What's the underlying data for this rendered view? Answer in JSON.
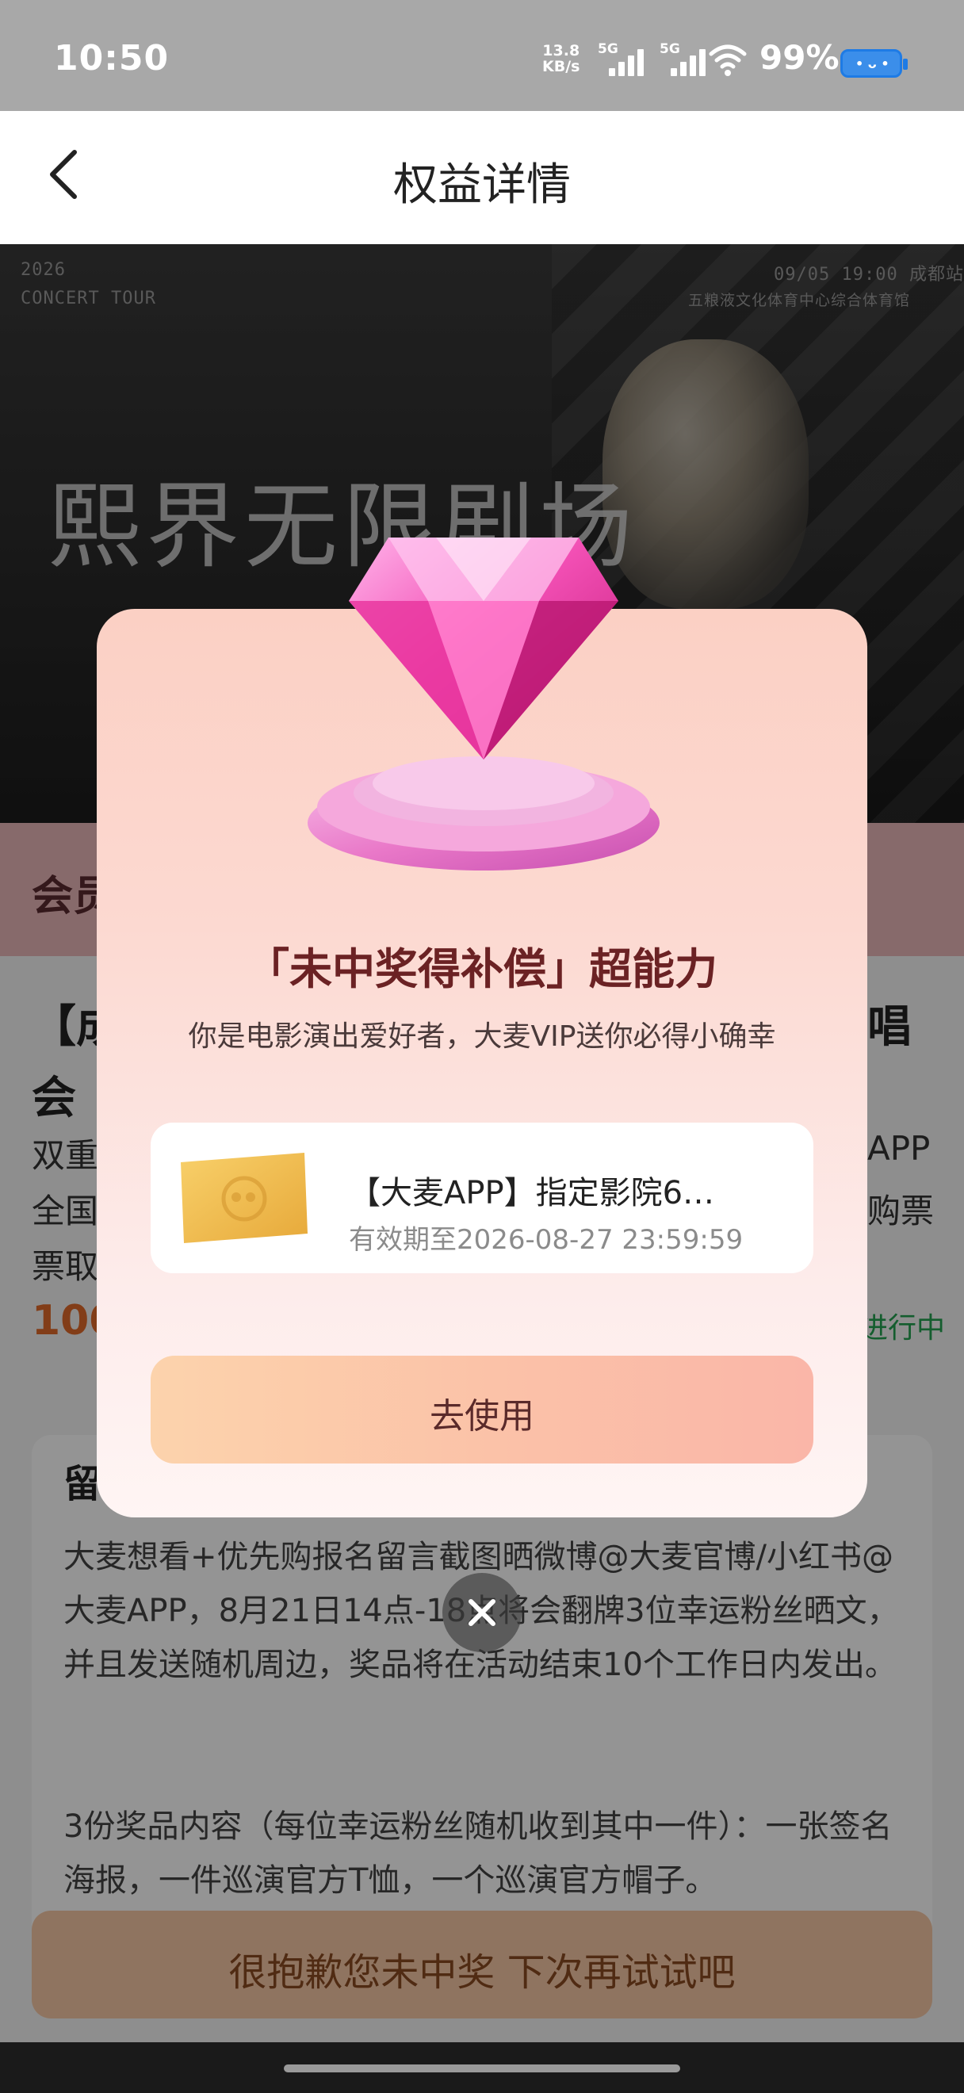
{
  "status_bar": {
    "time": "10:50",
    "speed_value": "13.8",
    "speed_unit": "KB/s",
    "signal1": "5G",
    "signal2": "5G",
    "battery": "99%"
  },
  "header": {
    "title": "权益详情"
  },
  "poster": {
    "year": "2026",
    "tour": "CONCERT TOUR",
    "date": "09/05  19:00  成都站",
    "venue": "五粮液文化体育中心综合体育馆",
    "title_art": "熙界无限剧场"
  },
  "background_page": {
    "band_label": "会员",
    "event_title_line1": "【成",
    "event_title_end": "唱",
    "event_title_line2": "会",
    "desc_line1_start": "双重",
    "desc_line1_end": "APP",
    "desc_line2_start": "全国",
    "desc_line2_end": "购票",
    "desc_line3_start": "票取",
    "price_start": "100",
    "status_end": "进行中",
    "section_heading": "留",
    "paragraph1": "大麦想看+优先购报名留言截图晒微博@大麦官博/小红书@大麦APP，8月21日14点-18点将会翻牌3位幸运粉丝晒文，并且发送随机周边，奖品将在活动结束10个工作日内发出。",
    "paragraph2": "3份奖品内容（每位幸运粉丝随机收到其中一件）：一张签名海报，一件巡演官方T恤，一个巡演官方帽子。",
    "bottom_button": "很抱歉您未中奖 下次再试试吧"
  },
  "modal": {
    "title": "「未中奖得补偿」超能力",
    "subtitle": "你是电影演出爱好者，大麦VIP送你必得小确幸",
    "coupon": {
      "name": "【大麦APP】指定影院6…",
      "expiry": "有效期至2026-08-27 23:59:59"
    },
    "use_button": "去使用"
  },
  "colors": {
    "accent": "#6b2224",
    "button_gradient_start": "#fcd3ac",
    "button_gradient_end": "#fab6a8",
    "status_bar": "#a8a8a8"
  }
}
